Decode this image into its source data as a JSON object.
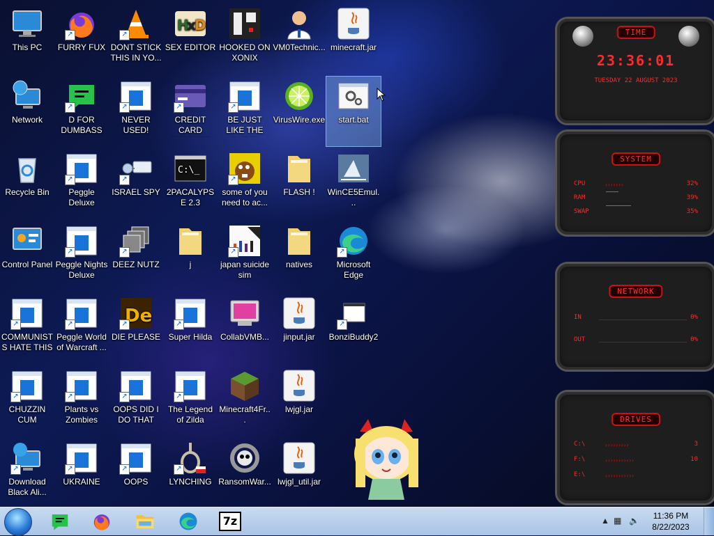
{
  "desktop": {
    "icons": [
      {
        "label": "This PC"
      },
      {
        "label": "FURRY FUX"
      },
      {
        "label": "DONT STICK THIS IN YO..."
      },
      {
        "label": "SEX EDITOR"
      },
      {
        "label": "HOOKED ON XONIX"
      },
      {
        "label": "VM0Technic..."
      },
      {
        "label": "minecraft.jar"
      },
      {
        "label": "Network"
      },
      {
        "label": "D FOR DUMBASS"
      },
      {
        "label": "NEVER USED!"
      },
      {
        "label": "CREDIT CARD CHECKER"
      },
      {
        "label": "BE JUST LIKE THE DUDE!"
      },
      {
        "label": "VirusWire.exe"
      },
      {
        "label": "start.bat"
      },
      {
        "label": "Recycle Bin"
      },
      {
        "label": "Peggle Deluxe"
      },
      {
        "label": "ISRAEL SPY"
      },
      {
        "label": "2PACALYPSE 2.3"
      },
      {
        "label": "some of you need to ac..."
      },
      {
        "label": "FLASH !"
      },
      {
        "label": "WinCE5Emul..."
      },
      {
        "label": "Control Panel"
      },
      {
        "label": "Peggle Nights Deluxe"
      },
      {
        "label": "DEEZ NUTZ"
      },
      {
        "label": "j"
      },
      {
        "label": "japan suicide sim"
      },
      {
        "label": "natives"
      },
      {
        "label": "Microsoft Edge"
      },
      {
        "label": "COMMUNISTS HATE THIS G..."
      },
      {
        "label": "Peggle World of Warcraft ..."
      },
      {
        "label": "DIE PLEASE"
      },
      {
        "label": "Super Hilda"
      },
      {
        "label": "CollabVMB..."
      },
      {
        "label": "jinput.jar"
      },
      {
        "label": "BonziBuddy2"
      },
      {
        "label": "CHUZZIN CUM"
      },
      {
        "label": "Plants vs Zombies"
      },
      {
        "label": "OOPS DID I DO THAT"
      },
      {
        "label": "The Legend of Zilda"
      },
      {
        "label": "Minecraft4Fr..."
      },
      {
        "label": "lwjgl.jar"
      },
      {
        "label": "Download Black Ali..."
      },
      {
        "label": "UKRAINE"
      },
      {
        "label": "OOPS"
      },
      {
        "label": "LYNCHING"
      },
      {
        "label": "RansomWar..."
      },
      {
        "label": "lwjgl_util.jar"
      }
    ]
  },
  "gadgets": {
    "time": {
      "title": "TIME",
      "clock": "23:36:01",
      "date": "TUESDAY 22 AUGUST 2023"
    },
    "system": {
      "title": "SYSTEM",
      "rows": [
        {
          "key": "CPU",
          "value": "32%"
        },
        {
          "key": "RAM",
          "value": "39%"
        },
        {
          "key": "SWAP",
          "value": "35%"
        }
      ]
    },
    "network": {
      "title": "NETWORK",
      "rows": [
        {
          "key": "IN",
          "value": "0%"
        },
        {
          "key": "OUT",
          "value": "0%"
        }
      ]
    },
    "drives": {
      "title": "DRIVES",
      "rows": [
        {
          "key": "C:\\",
          "value": "3"
        },
        {
          "key": "F:\\",
          "value": "10"
        },
        {
          "key": "E:\\",
          "value": ""
        }
      ]
    }
  },
  "taskbar": {
    "pinned": [
      "green-chat-icon",
      "firefox-icon",
      "file-explorer-icon",
      "edge-icon",
      "7zip-icon"
    ],
    "sevenzip_label": "7z",
    "clock": {
      "time": "11:36 PM",
      "date": "8/22/2023"
    }
  }
}
